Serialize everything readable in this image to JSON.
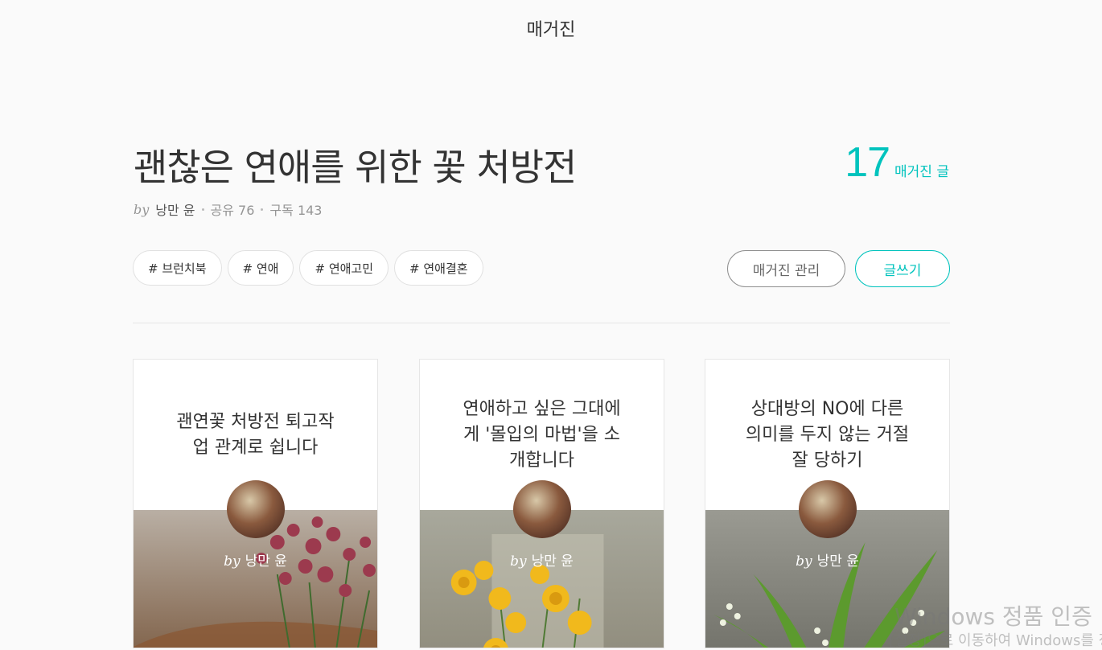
{
  "header": {
    "title": "매거진"
  },
  "magazine": {
    "title": "괜찮은 연애를 위한 꽃 처방전",
    "by_label": "by",
    "author": "낭만 윤",
    "share": "공유 76",
    "subscribe": "구독 143",
    "count": "17",
    "count_label": "매거진 글"
  },
  "tags": [
    "# 브런치북",
    "# 연애",
    "# 연애고민",
    "# 연애결혼"
  ],
  "actions": {
    "manage": "매거진 관리",
    "write": "글쓰기"
  },
  "cards": [
    {
      "title": "괜연꽃 처방전 퇴고작업 관계로 쉽니다",
      "by": "by",
      "author": "낭만 윤"
    },
    {
      "title": "연애하고 싶은 그대에게 '몰입의 마법'을 소개합니다",
      "by": "by",
      "author": "낭만 윤"
    },
    {
      "title": "상대방의 NO에 다른 의미를 두지 않는 거절 잘 당하기",
      "by": "by",
      "author": "낭만 윤"
    }
  ],
  "watermark": {
    "line1": "Windows 정품 인증",
    "line2": "[설정]으로 이동하여 Windows를 정품 인증합니다."
  },
  "colors": {
    "accent": "#00c3bd",
    "text": "#333333",
    "muted": "#959595"
  }
}
